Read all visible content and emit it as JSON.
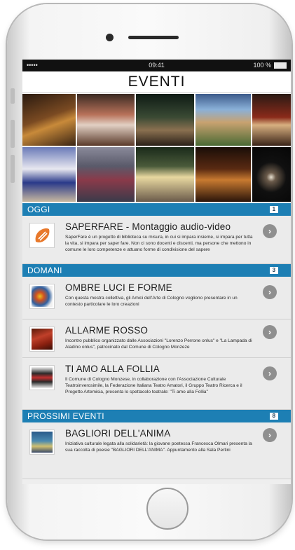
{
  "status_bar": {
    "signal": "••••• ",
    "time": "09:41",
    "battery": "100 %"
  },
  "header": {
    "title": "EVENTI"
  },
  "gallery_icons": [
    "photo-stage-concert-icon",
    "photo-orchestra-icon",
    "photo-evening-crowd-icon",
    "photo-courtyard-icon",
    "photo-dalai-lama-icon",
    "photo-majorettes-icon",
    "photo-street-market-icon",
    "photo-festival-tent-icon",
    "photo-candlelight-icon",
    "photo-theater-stage-icon"
  ],
  "sections": {
    "oggi": {
      "label": "OGGI",
      "count": "1"
    },
    "domani": {
      "label": "DOMANI",
      "count": "3"
    },
    "prossimi": {
      "label": "PROSSIMI EVENTI",
      "count": "8"
    }
  },
  "events": {
    "saperfare": {
      "title": "SAPERFARE - Montaggio audio-video",
      "description": "SaperFare è un progetto di biblioteca su misura, in cui si impara insieme, si impara per tutta la vita, si impara per saper fare. Non ci sono docenti e discenti, ma persone che mettono in comune le loro competenze e attuano forme di condivisione del sapere",
      "thumb_icon": "saperfare-logo-icon"
    },
    "ombre": {
      "title": "OMBRE LUCI E FORME",
      "description": "Con questa mostra collettiva, gli Amici dell'Arte di Cologno vogliono presentare in un contesto particolare le loro creazioni",
      "thumb_icon": "painting-icon"
    },
    "allarme": {
      "title": "ALLARME ROSSO",
      "description": "Incontro pubblico organizzato dalle Associazioni \"Lorenzo Perrone onlus\" e \"La Lampada di Aladino onlus\", patrocinato dal Comune di Cologno Monzeze",
      "thumb_icon": "red-food-icon"
    },
    "follia": {
      "title": "TI AMO ALLA FOLLIA",
      "description": "Il Comune di Cologno Monzese, in collaborazione con l'Associazione Culturale Teatroinverosimile, la Federazione Italiana Teatro Amatori, il Gruppo Teatro Ricerca e il Progetto Artemisia, presenta lo spettacolo teatrale: \"Ti amo alla Follia\"",
      "thumb_icon": "theater-poster-icon"
    },
    "bagliori": {
      "title": "BAGLIORI DELL'ANIMA",
      "description": "Iniziativa culturale legata alla solidarietà: la giovane poetessa Francesca Olmari presenta la sua raccolta di poesie \"BAGLIORI DELL'ANIMA\". Appuntamento alla Sala Pertini",
      "thumb_icon": "book-cover-icon"
    }
  },
  "arrow_symbol": "›",
  "colors": {
    "section_header": "#1d7fb4",
    "arrow_button": "#8f8f8f",
    "list_background": "#ebebeb"
  }
}
